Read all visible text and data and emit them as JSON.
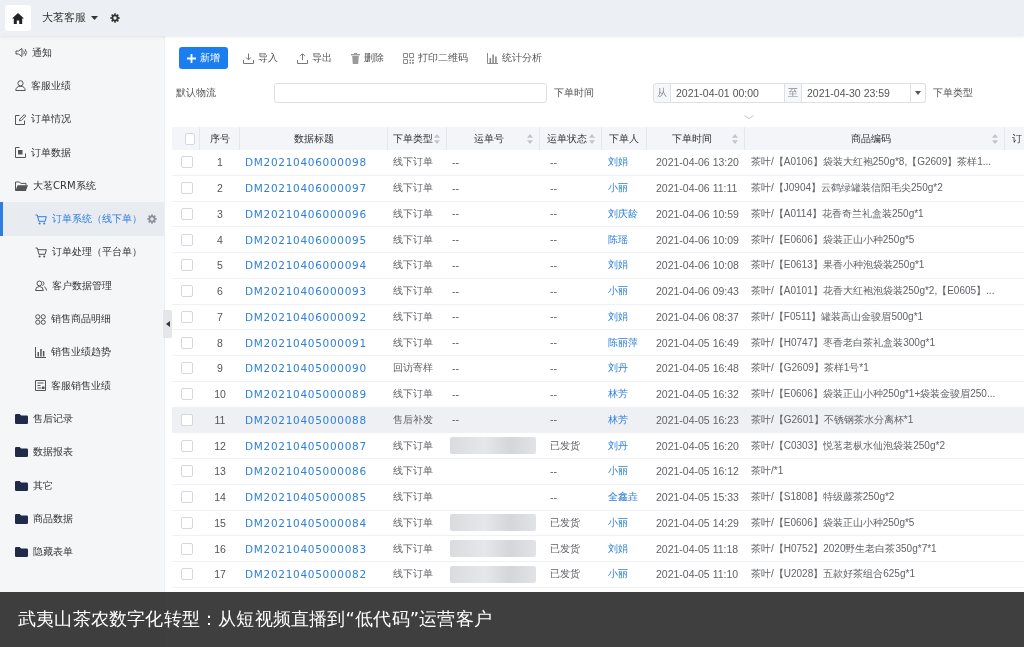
{
  "topbar": {
    "workspace": "大茗客服"
  },
  "sidebar": {
    "items": [
      {
        "label": "通知",
        "kind": "page",
        "selected": false
      },
      {
        "label": "客服业绩",
        "kind": "page",
        "selected": false
      },
      {
        "label": "订单情况",
        "kind": "page",
        "selected": false
      },
      {
        "label": "订单数据",
        "kind": "page",
        "selected": false
      },
      {
        "label": "大茗CRM系统",
        "kind": "folder",
        "selected": false,
        "expanded": true,
        "children": [
          {
            "label": "订单系统（线下单）",
            "selected": true
          },
          {
            "label": "订单处理（平台单）",
            "selected": false
          },
          {
            "label": "客户数据管理",
            "selected": false
          },
          {
            "label": "销售商品明细",
            "selected": false
          },
          {
            "label": "销售业绩趋势",
            "selected": false
          },
          {
            "label": "客服销售业绩",
            "selected": false
          }
        ]
      },
      {
        "label": "售后记录",
        "kind": "folder",
        "selected": false,
        "expanded": false
      },
      {
        "label": "数据报表",
        "kind": "folder",
        "selected": false,
        "expanded": false
      },
      {
        "label": "其它",
        "kind": "folder",
        "selected": false,
        "expanded": false
      },
      {
        "label": "商品数据",
        "kind": "folder",
        "selected": false,
        "expanded": false
      },
      {
        "label": "隐藏表单",
        "kind": "folder",
        "selected": false,
        "expanded": false
      }
    ]
  },
  "toolbar": [
    {
      "label": "新增",
      "kind": "primary"
    },
    {
      "label": "导入",
      "kind": "plain"
    },
    {
      "label": "导出",
      "kind": "plain"
    },
    {
      "label": "删除",
      "kind": "plain"
    },
    {
      "label": "打印二维码",
      "kind": "plain"
    },
    {
      "label": "统计分析",
      "kind": "plain"
    }
  ],
  "filters": {
    "logistics": {
      "label": "默认物流"
    },
    "order_time": {
      "label": "下单时间",
      "from_label": "从",
      "from": "2021-04-01 00:00",
      "to_label": "至",
      "to": "2021-04-30 23:59"
    },
    "order_type": {
      "label": "下单类型"
    }
  },
  "table": {
    "header_checked": false,
    "columns": [
      {
        "label": "序号",
        "sortable": false
      },
      {
        "label": "数据标题",
        "sortable": false
      },
      {
        "label": "下单类型",
        "sortable": true
      },
      {
        "label": "运单号",
        "sortable": true
      },
      {
        "label": "运单状态",
        "sortable": true
      },
      {
        "label": "下单人",
        "sortable": false
      },
      {
        "label": "下单时间",
        "sortable": true
      },
      {
        "label": "商品编码",
        "sortable": true
      },
      {
        "label": "订",
        "sortable": false
      }
    ],
    "rows": [
      {
        "checked": false,
        "hovered": false,
        "no": "1",
        "title": "DM20210406000098",
        "type": "线下订单",
        "waybill": "--",
        "redacted": false,
        "status": "--",
        "customer": "刘娟",
        "time": "2021-04-06 13:20",
        "product": "茶叶/【A0106】袋装大红袍250g*8,【G2609】茶样1..."
      },
      {
        "checked": false,
        "hovered": false,
        "no": "2",
        "title": "DM20210406000097",
        "type": "线下订单",
        "waybill": "--",
        "redacted": false,
        "status": "--",
        "customer": "小丽",
        "time": "2021-04-06 11:11",
        "product": "茶叶/【J0904】云鹤绿罐装信阳毛尖250g*2"
      },
      {
        "checked": false,
        "hovered": false,
        "no": "3",
        "title": "DM20210406000096",
        "type": "线下订单",
        "waybill": "--",
        "redacted": false,
        "status": "--",
        "customer": "刘庆龄",
        "time": "2021-04-06 10:59",
        "product": "茶叶/【A0114】花香奇兰礼盒装250g*1"
      },
      {
        "checked": false,
        "hovered": false,
        "no": "4",
        "title": "DM20210406000095",
        "type": "线下订单",
        "waybill": "--",
        "redacted": false,
        "status": "--",
        "customer": "陈瑶",
        "time": "2021-04-06 10:09",
        "product": "茶叶/【E0606】袋装正山小种250g*5"
      },
      {
        "checked": false,
        "hovered": false,
        "no": "5",
        "title": "DM20210406000094",
        "type": "线下订单",
        "waybill": "--",
        "redacted": false,
        "status": "--",
        "customer": "刘娟",
        "time": "2021-04-06 10:08",
        "product": "茶叶/【E0613】果香小种泡袋装250g*1"
      },
      {
        "checked": false,
        "hovered": false,
        "no": "6",
        "title": "DM20210406000093",
        "type": "线下订单",
        "waybill": "--",
        "redacted": false,
        "status": "--",
        "customer": "小丽",
        "time": "2021-04-06 09:43",
        "product": "茶叶/【A0101】花香大红袍泡袋装250g*2,【E0605】..."
      },
      {
        "checked": false,
        "hovered": false,
        "no": "7",
        "title": "DM20210406000092",
        "type": "线下订单",
        "waybill": "--",
        "redacted": false,
        "status": "--",
        "customer": "刘娟",
        "time": "2021-04-06 08:37",
        "product": "茶叶/【F0511】罐装高山金骏眉500g*1"
      },
      {
        "checked": false,
        "hovered": false,
        "no": "8",
        "title": "DM20210405000091",
        "type": "线下订单",
        "waybill": "--",
        "redacted": false,
        "status": "--",
        "customer": "陈丽萍",
        "time": "2021-04-05 16:49",
        "product": "茶叶/【H0747】枣香老白茶礼盒装300g*1"
      },
      {
        "checked": false,
        "hovered": false,
        "no": "9",
        "title": "DM20210405000090",
        "type": "回访寄样",
        "waybill": "--",
        "redacted": false,
        "status": "--",
        "customer": "刘丹",
        "time": "2021-04-05 16:48",
        "product": "茶叶/【G2609】茶样1号*1"
      },
      {
        "checked": false,
        "hovered": false,
        "no": "10",
        "title": "DM20210405000089",
        "type": "线下订单",
        "waybill": "--",
        "redacted": false,
        "status": "--",
        "customer": "林芳",
        "time": "2021-04-05 16:32",
        "product": "茶叶/【E0606】袋装正山小种250g*1+袋装金骏眉250..."
      },
      {
        "checked": false,
        "hovered": true,
        "no": "11",
        "title": "DM20210405000088",
        "type": "售后补发",
        "waybill": "--",
        "redacted": false,
        "status": "--",
        "customer": "林芳",
        "time": "2021-04-05 16:23",
        "product": "茶叶/【G2601】不锈钢茶水分离杯*1"
      },
      {
        "checked": false,
        "hovered": false,
        "no": "12",
        "title": "DM20210405000087",
        "type": "线下订单",
        "redacted": true,
        "status": "已发货",
        "customer": "刘丹",
        "time": "2021-04-05 16:20",
        "product": "茶叶/【C0303】悦茗老枞水仙泡袋装250g*2"
      },
      {
        "checked": false,
        "hovered": false,
        "no": "13",
        "title": "DM20210405000086",
        "type": "线下订单",
        "redacted": false,
        "status": "--",
        "customer": "小丽",
        "time": "2021-04-05 16:12",
        "product": "茶叶/*1"
      },
      {
        "checked": false,
        "hovered": false,
        "no": "14",
        "title": "DM20210405000085",
        "type": "线下订单",
        "redacted": false,
        "status": "--",
        "customer": "全鑫垚",
        "time": "2021-04-05 15:33",
        "product": "茶叶/【S1808】特级藤茶250g*2"
      },
      {
        "checked": false,
        "hovered": false,
        "no": "15",
        "title": "DM20210405000084",
        "type": "线下订单",
        "redacted": true,
        "status": "已发货",
        "customer": "小丽",
        "time": "2021-04-05 14:29",
        "product": "茶叶/【E0606】袋装正山小种250g*5"
      },
      {
        "checked": false,
        "hovered": false,
        "no": "16",
        "title": "DM20210405000083",
        "type": "线下订单",
        "redacted": true,
        "status": "已发货",
        "customer": "刘娟",
        "time": "2021-04-05 11:18",
        "product": "茶叶/【H0752】2020野生老白茶350g*7*1"
      },
      {
        "checked": false,
        "hovered": false,
        "no": "17",
        "title": "DM20210405000082",
        "type": "线下订单",
        "redacted": true,
        "status": "已发货",
        "customer": "小丽",
        "time": "2021-04-05 11:10",
        "product": "茶叶/【U2028】五款好茶组合625g*1"
      }
    ]
  },
  "caption": "武夷山茶农数字化转型：从短视频直播到“低代码”运营客户"
}
